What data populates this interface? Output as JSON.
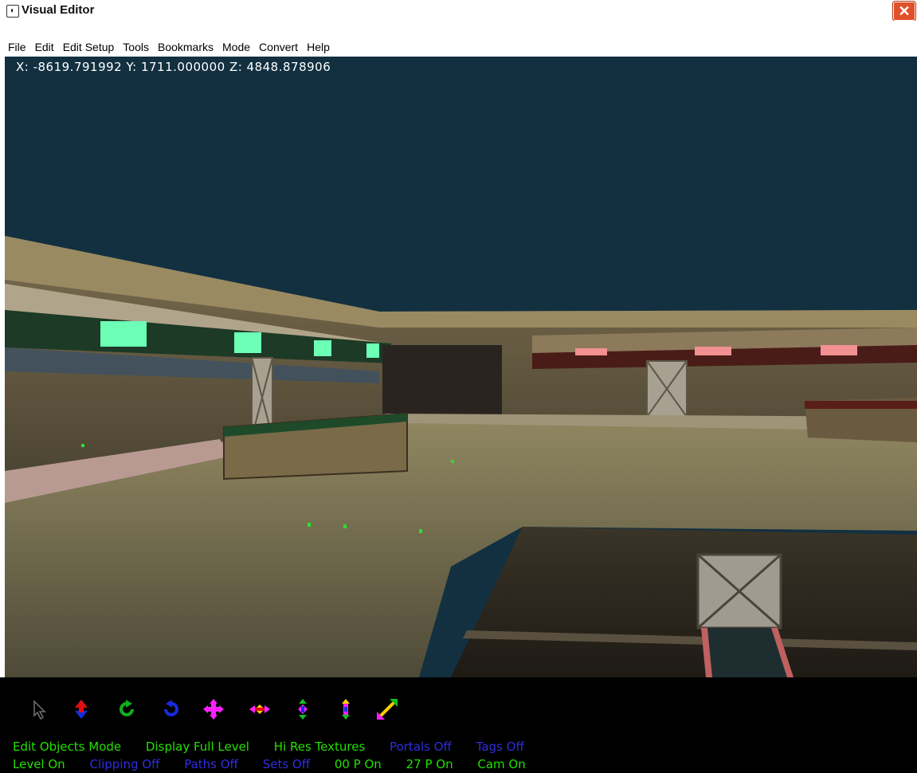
{
  "window": {
    "title": "Visual Editor",
    "app_icon": "editor-app-icon",
    "close_icon": "close-icon"
  },
  "menu": [
    "File",
    "Edit",
    "Edit Setup",
    "Tools",
    "Bookmarks",
    "Mode",
    "Convert",
    "Help"
  ],
  "viewport": {
    "coordinates": "X: -8619.791992 Y: 1711.000000 Z: 4848.878906"
  },
  "toolbar": {
    "tools": [
      {
        "icon": "select-arrow-icon"
      },
      {
        "icon": "move-vertical-icon"
      },
      {
        "icon": "rotate-cw-green-icon"
      },
      {
        "icon": "rotate-ccw-blue-icon"
      },
      {
        "icon": "move-all-directions-icon"
      },
      {
        "icon": "move-horizontal-icon"
      },
      {
        "icon": "move-depth-icon"
      },
      {
        "icon": "scale-vertical-icon"
      },
      {
        "icon": "scale-diagonal-icon"
      }
    ]
  },
  "status": {
    "row1": [
      {
        "text": "Edit Objects Mode",
        "state": "on"
      },
      {
        "text": "Display Full Level",
        "state": "on"
      },
      {
        "text": "Hi Res Textures",
        "state": "on"
      },
      {
        "text": "Portals Off",
        "state": "off"
      },
      {
        "text": "Tags Off",
        "state": "off"
      }
    ],
    "row2": [
      {
        "text": "Level On",
        "state": "on"
      },
      {
        "text": "Clipping Off",
        "state": "off"
      },
      {
        "text": "Paths Off",
        "state": "off"
      },
      {
        "text": "Sets Off",
        "state": "off"
      },
      {
        "text": "00 P On",
        "state": "on"
      },
      {
        "text": "27 P On",
        "state": "on"
      },
      {
        "text": "Cam On",
        "state": "on"
      }
    ]
  },
  "colors": {
    "sky": "#123040",
    "status_on": "#22e000",
    "status_off": "#2e2ee0"
  }
}
